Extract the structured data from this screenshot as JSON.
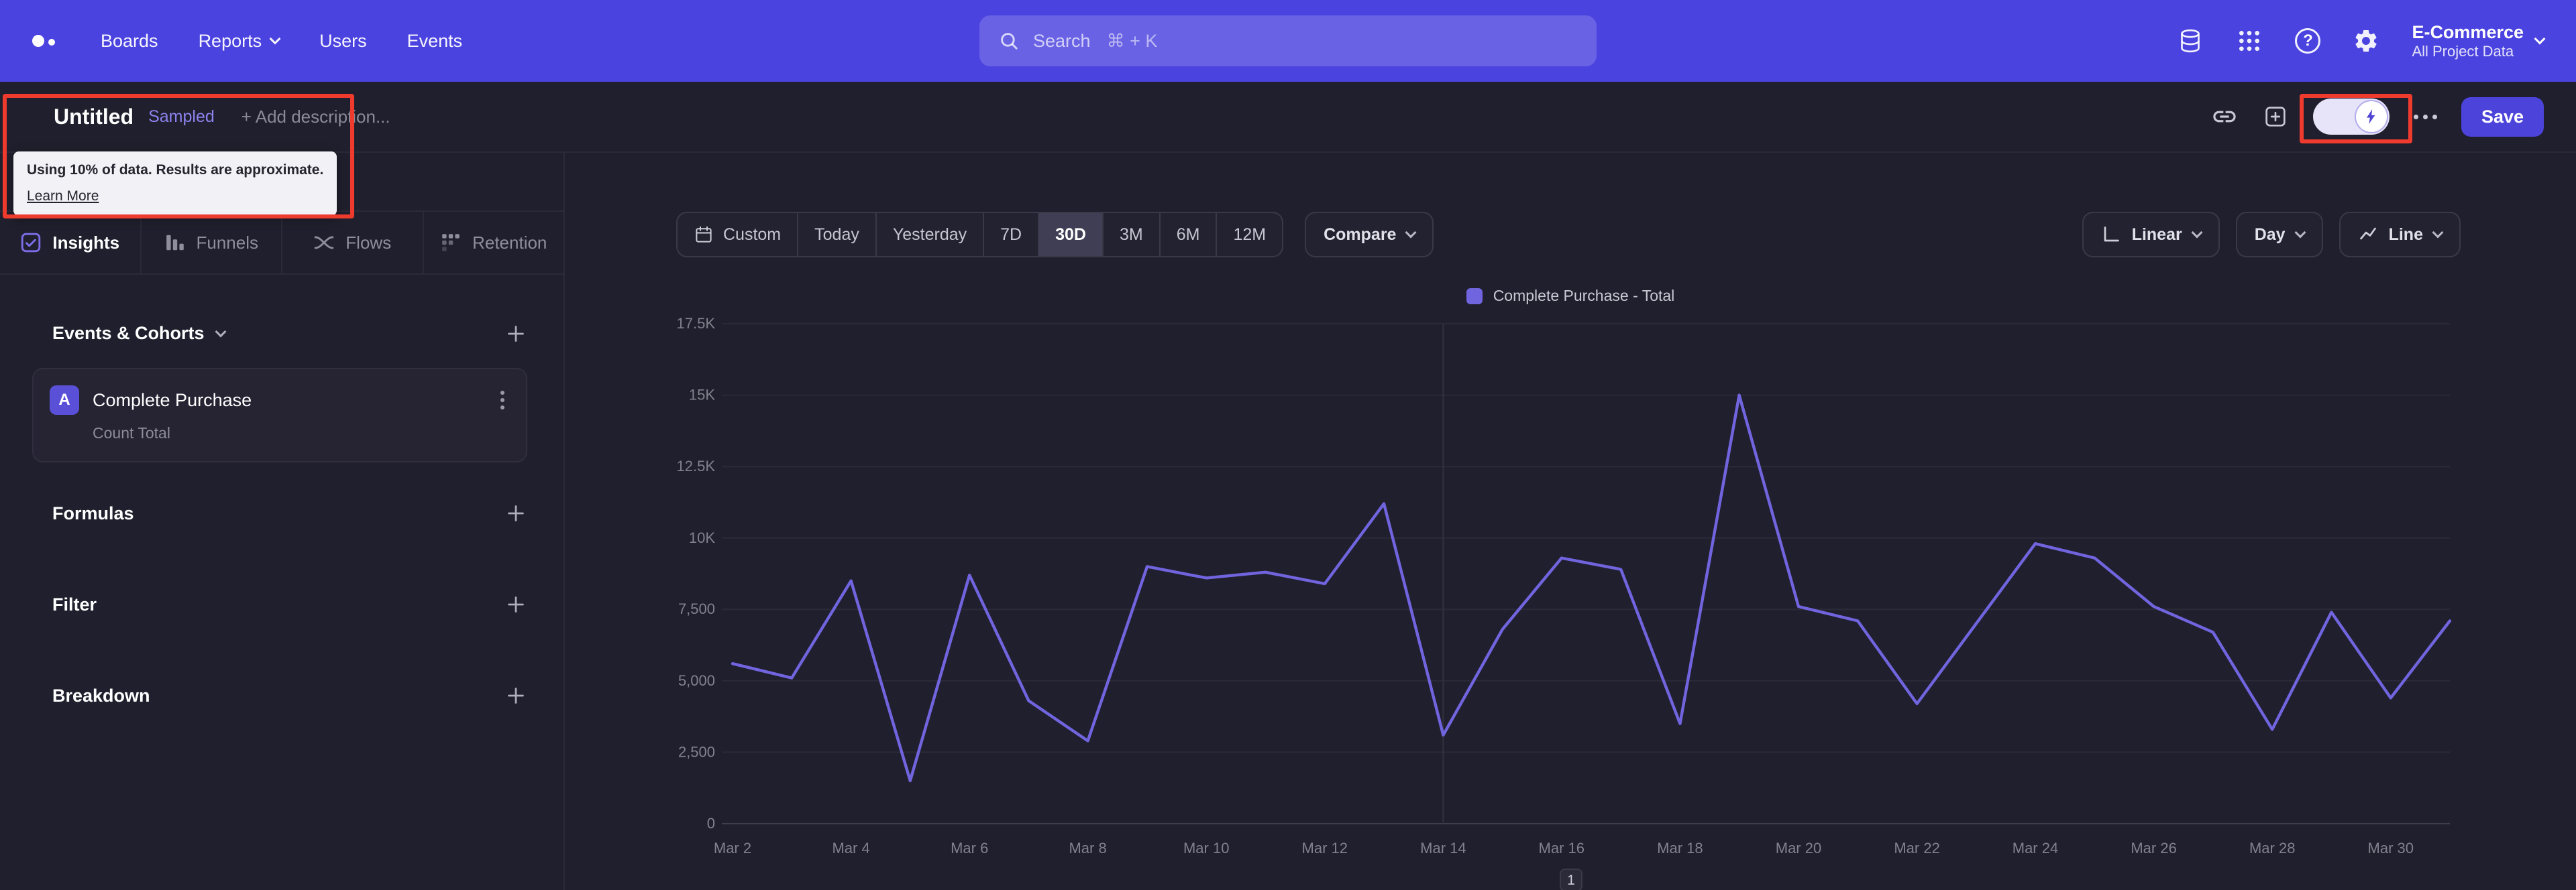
{
  "colors": {
    "nav_accent": "#4b43df",
    "line": "#7165df",
    "annotation_red": "#ee3b2e",
    "sampled_purple": "#8d83ef"
  },
  "topnav": {
    "items": [
      "Boards",
      "Reports",
      "Users",
      "Events"
    ],
    "search": {
      "label": "Search",
      "shortcut": "⌘ + K"
    },
    "project": {
      "name": "E-Commerce",
      "scope": "All Project Data"
    }
  },
  "header": {
    "title": "Untitled",
    "sampled_badge": "Sampled",
    "add_description": "+ Add description...",
    "sampling_tooltip": {
      "text": "Using 10% of data. Results are approximate.",
      "link": "Learn More"
    },
    "save_label": "Save"
  },
  "sidebar": {
    "tabs": [
      "Insights",
      "Funnels",
      "Flows",
      "Retention"
    ],
    "active_tab": "Insights",
    "events_section_title": "Events & Cohorts",
    "event": {
      "badge": "A",
      "name": "Complete Purchase",
      "metric": "Count Total"
    },
    "sections": [
      "Formulas",
      "Filter",
      "Breakdown"
    ]
  },
  "controls": {
    "date_ranges": [
      "Custom",
      "Today",
      "Yesterday",
      "7D",
      "30D",
      "3M",
      "6M",
      "12M"
    ],
    "selected_range": "30D",
    "compare_label": "Compare",
    "value_scale": "Linear",
    "granularity": "Day",
    "chart_type": "Line"
  },
  "chart_data": {
    "type": "line",
    "legend": "Complete Purchase - Total",
    "x": [
      "Mar 2",
      "Mar 3",
      "Mar 4",
      "Mar 5",
      "Mar 6",
      "Mar 7",
      "Mar 8",
      "Mar 9",
      "Mar 10",
      "Mar 11",
      "Mar 12",
      "Mar 13",
      "Mar 14",
      "Mar 15",
      "Mar 16",
      "Mar 17",
      "Mar 18",
      "Mar 19",
      "Mar 20",
      "Mar 21",
      "Mar 22",
      "Mar 23",
      "Mar 24",
      "Mar 25",
      "Mar 26",
      "Mar 27",
      "Mar 28",
      "Mar 29",
      "Mar 30",
      "Mar 31"
    ],
    "series": [
      {
        "name": "Complete Purchase - Total",
        "color": "#7165df",
        "values": [
          5600,
          5100,
          8500,
          1500,
          8700,
          4300,
          2900,
          9000,
          8600,
          8800,
          8400,
          11200,
          3100,
          6800,
          9300,
          8900,
          3500,
          15000,
          7600,
          7100,
          4200,
          7000,
          9800,
          9300,
          7600,
          6700,
          3300,
          7400,
          4400,
          7100
        ]
      }
    ],
    "y_ticks": [
      0,
      2500,
      5000,
      7500,
      10000,
      12500,
      15000,
      17500
    ],
    "y_tick_labels": [
      "0",
      "2,500",
      "5,000",
      "7,500",
      "10K",
      "12.5K",
      "15K",
      "17.5K"
    ],
    "ylim": [
      0,
      17500
    ],
    "grid": true,
    "legend_position": "top-center",
    "vline_x": "Mar 14",
    "pagination": "1"
  }
}
